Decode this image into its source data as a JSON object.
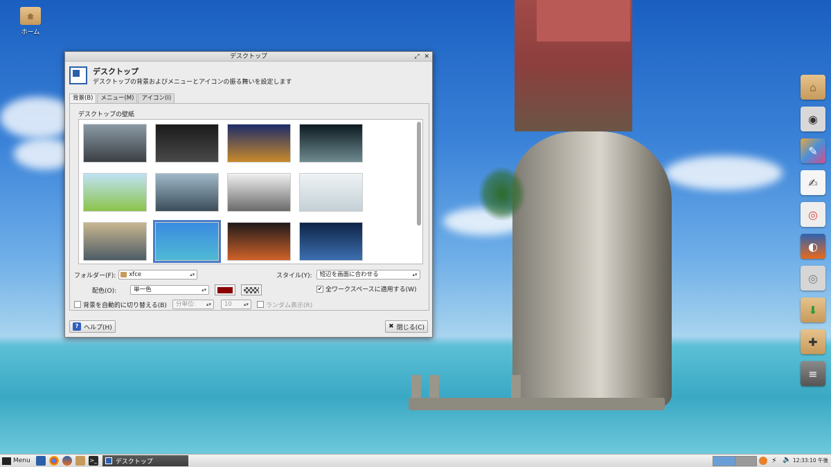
{
  "desktop": {
    "icons": [
      {
        "label": "ホーム",
        "icon": "folder-home-icon"
      }
    ]
  },
  "dock": [
    {
      "icon": "home-folder-icon",
      "color": "#d9b07a"
    },
    {
      "icon": "camera-icon",
      "color": "#3a3a3a"
    },
    {
      "icon": "paint-icon",
      "color": "#e8a53c"
    },
    {
      "icon": "text-editor-icon",
      "color": "#f5f5f5"
    },
    {
      "icon": "chrome-icon",
      "color": "#e9e9e9"
    },
    {
      "icon": "firefox-icon",
      "color": "#2f62b0"
    },
    {
      "icon": "disc-icon",
      "color": "#d0d0d0"
    },
    {
      "icon": "package-install-icon",
      "color": "#d9b07a"
    },
    {
      "icon": "package-add-icon",
      "color": "#d9b07a"
    },
    {
      "icon": "mixer-icon",
      "color": "#6b6b6b"
    }
  ],
  "dialog": {
    "window_title": "デスクトップ",
    "header_title": "デスクトップ",
    "header_subtitle": "デスクトップの背景およびメニューとアイコンの振る舞いを設定します",
    "tabs": [
      {
        "label": "背景(B)",
        "active": true
      },
      {
        "label": "メニュー(M)",
        "active": false
      },
      {
        "label": "アイコン(I)",
        "active": false
      }
    ],
    "section_label": "デスクトップの壁紙",
    "wallpapers": [
      {
        "name": "car",
        "colors": [
          "#8a9aa5",
          "#3b3f44"
        ]
      },
      {
        "name": "cube",
        "colors": [
          "#1a1a1a",
          "#4a4a4a"
        ]
      },
      {
        "name": "brandenburg-gate",
        "colors": [
          "#1d2c6a",
          "#c98a2b"
        ]
      },
      {
        "name": "portal",
        "colors": [
          "#0c1a20",
          "#6e8a90"
        ]
      },
      {
        "name": "flowers",
        "colors": [
          "#bfe3f5",
          "#8bc34a"
        ]
      },
      {
        "name": "lake-mountains",
        "colors": [
          "#9fb8c8",
          "#3c4d5a"
        ]
      },
      {
        "name": "statue-of-liberty",
        "colors": [
          "#f0f0f0",
          "#6a6a6a"
        ]
      },
      {
        "name": "bird",
        "colors": [
          "#eef3f5",
          "#c4d0d6"
        ]
      },
      {
        "name": "boats-sunset",
        "colors": [
          "#c8b68f",
          "#4d5b66"
        ]
      },
      {
        "name": "island-rock",
        "colors": [
          "#3a8be0",
          "#4fb9d4"
        ],
        "selected": true
      },
      {
        "name": "stadium-night",
        "colors": [
          "#201a1a",
          "#d0622a"
        ]
      },
      {
        "name": "city-night",
        "colors": [
          "#0e2447",
          "#3d6fb0"
        ]
      }
    ],
    "folder_label": "フォルダー(F):",
    "folder_value": "xfce",
    "style_label": "スタイル(Y):",
    "style_value": "短辺を画面に合わせる",
    "color_label": "配色(O):",
    "color_value": "単一色",
    "primary_color": "#8b0000",
    "apply_all_label": "全ワークスペースに適用する(W)",
    "apply_all_checked": true,
    "auto_change_label": "背景を自動的に切り替える(B)",
    "interval_unit": "分単位:",
    "interval_value": "10",
    "random_label": "ランダム表示(R)",
    "help_label": "ヘルプ(H)",
    "close_label": "閉じる(C)"
  },
  "taskbar": {
    "menu_label": "Menu",
    "active_task": "デスクトップ",
    "clock": "12:33:10 午後"
  }
}
